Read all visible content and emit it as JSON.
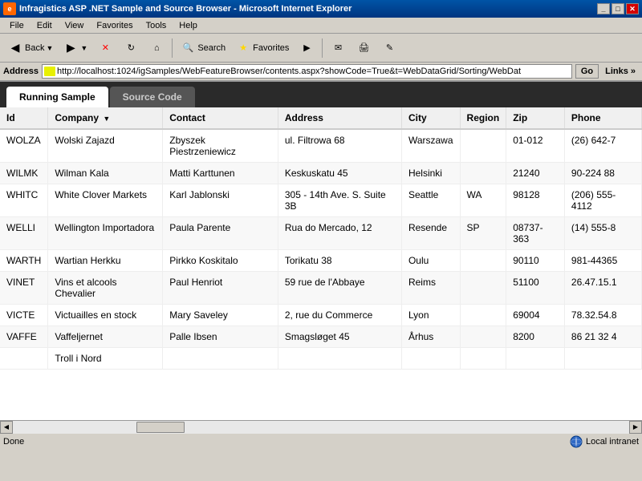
{
  "window": {
    "title": "Infragistics ASP .NET Sample and Source Browser - Microsoft Internet Explorer",
    "title_icon": "IE"
  },
  "menu": {
    "items": [
      "File",
      "Edit",
      "View",
      "Favorites",
      "Tools",
      "Help"
    ]
  },
  "toolbar": {
    "back_label": "Back",
    "forward_label": "",
    "stop_label": "✕",
    "refresh_label": "↻",
    "home_label": "⌂",
    "search_label": "Search",
    "favorites_label": "Favorites",
    "media_label": "",
    "mail_label": "✉",
    "print_label": "🖨",
    "edit_label": ""
  },
  "address_bar": {
    "label": "Address",
    "url": "http://localhost:1024/igSamples/WebFeatureBrowser/contents.aspx?showCode=True&t=WebDataGrid/Sorting/WebDat",
    "go_label": "Go",
    "links_label": "Links »"
  },
  "tabs": [
    {
      "label": "Running Sample",
      "active": true
    },
    {
      "label": "Source Code",
      "active": false
    }
  ],
  "grid": {
    "columns": [
      {
        "key": "id",
        "label": "Id",
        "sortable": true,
        "sorted": false
      },
      {
        "key": "company",
        "label": "Company",
        "sortable": true,
        "sorted": true,
        "sort_dir": "▼"
      },
      {
        "key": "contact",
        "label": "Contact",
        "sortable": true,
        "sorted": false
      },
      {
        "key": "address",
        "label": "Address",
        "sortable": true,
        "sorted": false
      },
      {
        "key": "city",
        "label": "City",
        "sortable": true,
        "sorted": false
      },
      {
        "key": "region",
        "label": "Region",
        "sortable": true,
        "sorted": false
      },
      {
        "key": "zip",
        "label": "Zip",
        "sortable": true,
        "sorted": false
      },
      {
        "key": "phone",
        "label": "Phone",
        "sortable": true,
        "sorted": false
      }
    ],
    "rows": [
      {
        "id": "WOLZA",
        "company": "Wolski Zajazd",
        "contact": "Zbyszek Piestrzeniewicz",
        "address": "ul. Filtrowa 68",
        "city": "Warszawa",
        "region": "",
        "zip": "01-012",
        "phone": "(26) 642-7"
      },
      {
        "id": "WILMK",
        "company": "Wilman Kala",
        "contact": "Matti Karttunen",
        "address": "Keskuskatu 45",
        "city": "Helsinki",
        "region": "",
        "zip": "21240",
        "phone": "90-224 88"
      },
      {
        "id": "WHITC",
        "company": "White Clover Markets",
        "contact": "Karl Jablonski",
        "address": "305 - 14th Ave. S. Suite 3B",
        "city": "Seattle",
        "region": "WA",
        "zip": "98128",
        "phone": "(206) 555-4112"
      },
      {
        "id": "WELLI",
        "company": "Wellington Importadora",
        "contact": "Paula Parente",
        "address": "Rua do Mercado, 12",
        "city": "Resende",
        "region": "SP",
        "zip": "08737-363",
        "phone": "(14) 555-8"
      },
      {
        "id": "WARTH",
        "company": "Wartian Herkku",
        "contact": "Pirkko Koskitalo",
        "address": "Torikatu 38",
        "city": "Oulu",
        "region": "",
        "zip": "90110",
        "phone": "981-44365"
      },
      {
        "id": "VINET",
        "company": "Vins et alcools Chevalier",
        "contact": "Paul Henriot",
        "address": "59 rue de l'Abbaye",
        "city": "Reims",
        "region": "",
        "zip": "51100",
        "phone": "26.47.15.1"
      },
      {
        "id": "VICTE",
        "company": "Victuailles en stock",
        "contact": "Mary Saveley",
        "address": "2, rue du Commerce",
        "city": "Lyon",
        "region": "",
        "zip": "69004",
        "phone": "78.32.54.8"
      },
      {
        "id": "VAFFE",
        "company": "Vaffeljernet",
        "contact": "Palle Ibsen",
        "address": "Smagsløget 45",
        "city": "Århus",
        "region": "",
        "zip": "8200",
        "phone": "86 21 32 4"
      }
    ]
  },
  "status": {
    "left": "Done",
    "right": "Local intranet"
  }
}
